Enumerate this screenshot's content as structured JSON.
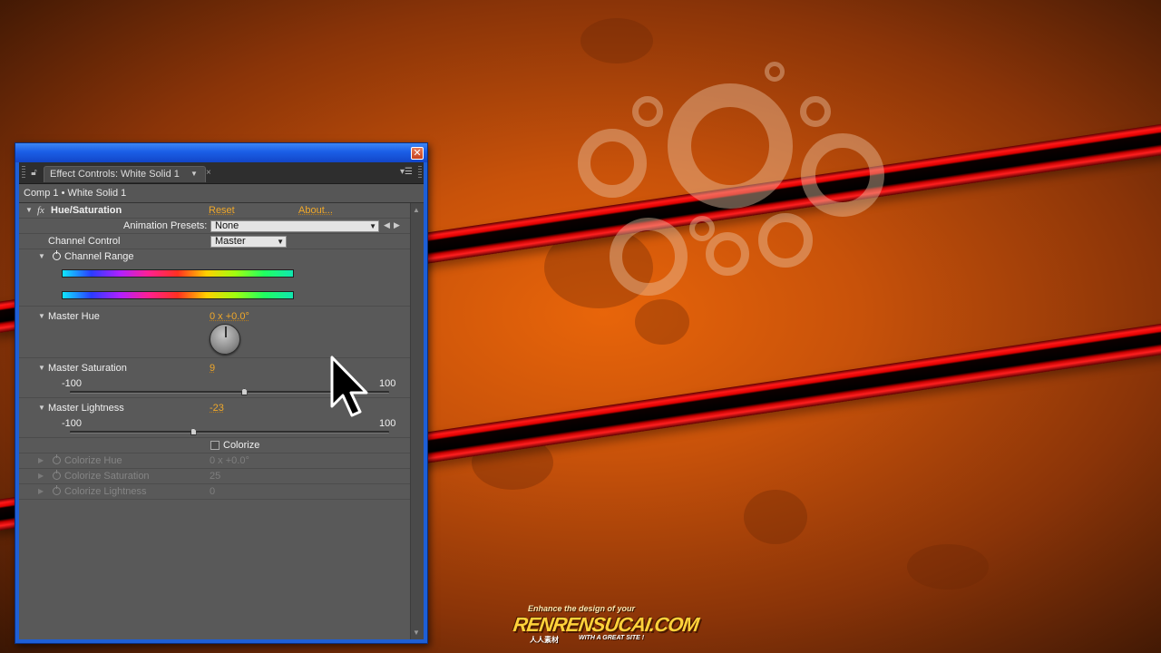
{
  "background": {
    "accent_colors": {
      "orange": "#d65a0a",
      "stripe_red": "#ff1a1a",
      "stripe_black": "#000000"
    }
  },
  "window": {
    "close_glyph": "✕",
    "panel": {
      "tab_label": "Effect Controls: White Solid 1",
      "tab_close_glyph": "×",
      "menu_glyph": "▾☰",
      "breadcrumb": "Comp 1 • White Solid 1"
    },
    "effect": {
      "name": "Hue/Saturation",
      "fx_label": "fx",
      "reset_label": "Reset",
      "about_label": "About...",
      "animation_presets_label": "Animation Presets:",
      "animation_presets_value": "None",
      "channel_control_label": "Channel Control",
      "channel_control_value": "Master",
      "channel_range_label": "Channel Range",
      "master_hue": {
        "label": "Master Hue",
        "value": "0 x +0.0°"
      },
      "master_saturation": {
        "label": "Master Saturation",
        "value": "9",
        "min": "-100",
        "max": "100",
        "slider_fraction": 0.545
      },
      "master_lightness": {
        "label": "Master Lightness",
        "value": "-23",
        "min": "-100",
        "max": "100",
        "slider_fraction": 0.385
      },
      "colorize_label": "Colorize",
      "colorize_checked": false,
      "colorize_hue": {
        "label": "Colorize Hue",
        "value": "0 x +0.0°"
      },
      "colorize_saturation": {
        "label": "Colorize Saturation",
        "value": "25"
      },
      "colorize_lightness": {
        "label": "Colorize Lightness",
        "value": "0"
      }
    }
  },
  "watermark": {
    "top_text": "Enhance the design of your",
    "logo_text": "RENRENSUCAI.COM",
    "bottom_left": "人人素材",
    "bottom_right": "WITH A GREAT SITE !"
  },
  "icons": [
    "close-icon",
    "lock-icon",
    "dropdown-arrow-icon",
    "panel-menu-icon",
    "twirl-triangle-icon",
    "stopwatch-icon",
    "hue-dial",
    "prev-keyframe-icon",
    "next-keyframe-icon",
    "mouse-cursor"
  ]
}
